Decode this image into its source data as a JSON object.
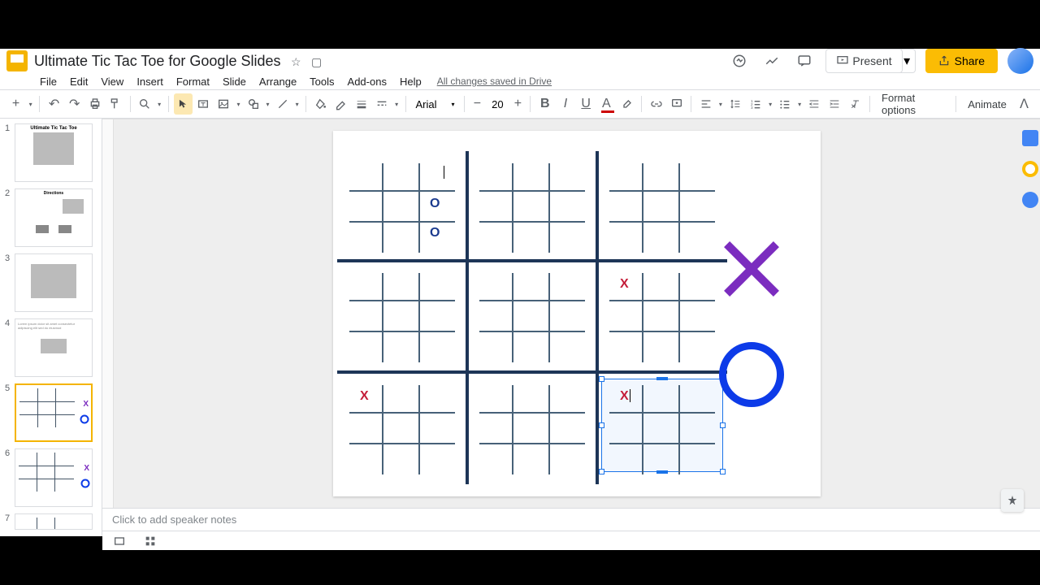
{
  "document": {
    "title": "Ultimate Tic Tac Toe for Google Slides",
    "save_status": "All changes saved in Drive"
  },
  "menu": {
    "file": "File",
    "edit": "Edit",
    "view": "View",
    "insert": "Insert",
    "format": "Format",
    "slide": "Slide",
    "arrange": "Arrange",
    "tools": "Tools",
    "addons": "Add-ons",
    "help": "Help"
  },
  "toolbar": {
    "font_family": "Arial",
    "font_size": "20",
    "format_options": "Format options",
    "animate": "Animate"
  },
  "header": {
    "present": "Present",
    "share": "Share"
  },
  "thumbnails": [
    {
      "num": "1",
      "title": "Ultimate Tic Tac Toe"
    },
    {
      "num": "2",
      "title": "Directions"
    },
    {
      "num": "3",
      "title": ""
    },
    {
      "num": "4",
      "title": ""
    },
    {
      "num": "5",
      "title": ""
    },
    {
      "num": "6",
      "title": ""
    },
    {
      "num": "7",
      "title": ""
    }
  ],
  "slide": {
    "marks": {
      "o1": "O",
      "o2": "O",
      "x1": "X",
      "x2": "X",
      "x3": "X"
    }
  },
  "notes": {
    "placeholder": "Click to add speaker notes"
  }
}
